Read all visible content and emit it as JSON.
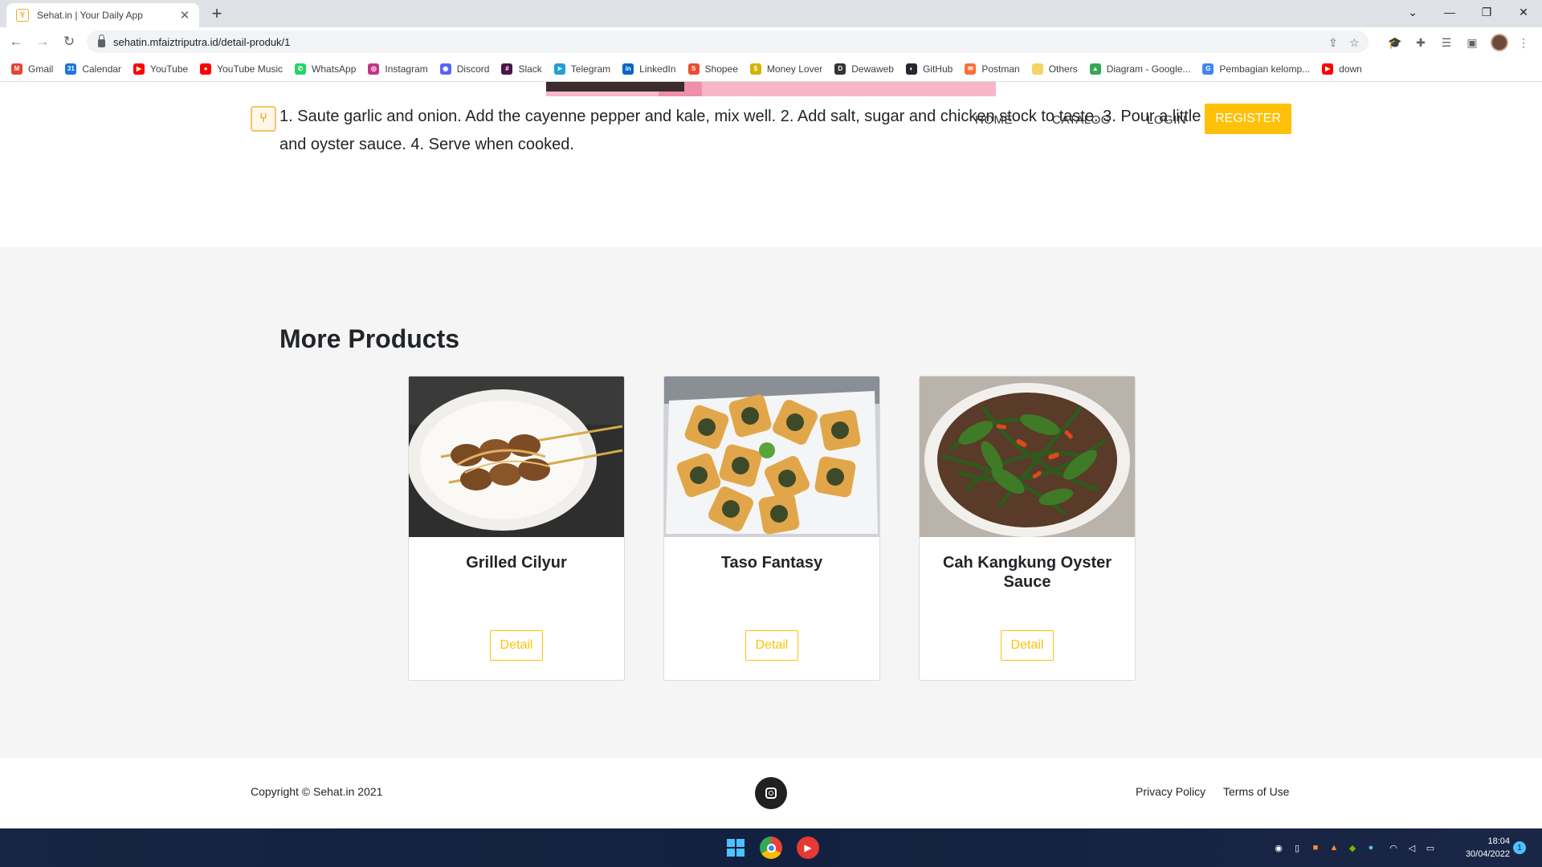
{
  "browser": {
    "tab_title": "Sehat.in | Your Daily App",
    "tab_close": "✕",
    "new_tab": "+",
    "url": "sehatin.mfaiztriputra.id/detail-produk/1",
    "back": "←",
    "forward": "→",
    "reload": "↻",
    "window_controls": {
      "dropdown": "⌄",
      "minimize": "—",
      "maximize": "❐",
      "close": "✕"
    },
    "bookmarks": [
      {
        "label": "Gmail",
        "icon": "gmail-icon",
        "color": "#ea4335",
        "glyph": "M"
      },
      {
        "label": "Calendar",
        "icon": "calendar-icon",
        "color": "#1a73e8",
        "glyph": "31"
      },
      {
        "label": "YouTube",
        "icon": "youtube-icon",
        "color": "#ff0000",
        "glyph": "▶"
      },
      {
        "label": "YouTube Music",
        "icon": "youtube-music-icon",
        "color": "#ff0000",
        "glyph": "●"
      },
      {
        "label": "WhatsApp",
        "icon": "whatsapp-icon",
        "color": "#25d366",
        "glyph": "✆"
      },
      {
        "label": "Instagram",
        "icon": "instagram-icon",
        "color": "#c13584",
        "glyph": "◎"
      },
      {
        "label": "Discord",
        "icon": "discord-icon",
        "color": "#5865f2",
        "glyph": "◉"
      },
      {
        "label": "Slack",
        "icon": "slack-icon",
        "color": "#4a154b",
        "glyph": "#"
      },
      {
        "label": "Telegram",
        "icon": "telegram-icon",
        "color": "#229ed9",
        "glyph": "➤"
      },
      {
        "label": "LinkedIn",
        "icon": "linkedin-icon",
        "color": "#0a66c2",
        "glyph": "in"
      },
      {
        "label": "Shopee",
        "icon": "shopee-icon",
        "color": "#ee4d2d",
        "glyph": "S"
      },
      {
        "label": "Money Lover",
        "icon": "money-lover-icon",
        "color": "#d4b400",
        "glyph": "$"
      },
      {
        "label": "Dewaweb",
        "icon": "dewaweb-icon",
        "color": "#333333",
        "glyph": "D"
      },
      {
        "label": "GitHub",
        "icon": "github-icon",
        "color": "#24292f",
        "glyph": "◐"
      },
      {
        "label": "Postman",
        "icon": "postman-icon",
        "color": "#ff6c37",
        "glyph": "✉"
      },
      {
        "label": "Others",
        "icon": "folder-icon",
        "color": "#f6d365",
        "glyph": ""
      },
      {
        "label": "Diagram - Google...",
        "icon": "google-drive-icon",
        "color": "#34a853",
        "glyph": "▲"
      },
      {
        "label": "Pembagian kelomp...",
        "icon": "google-icon",
        "color": "#4285f4",
        "glyph": "G"
      },
      {
        "label": "down",
        "icon": "youtube-icon",
        "color": "#ff0000",
        "glyph": "▶"
      }
    ]
  },
  "site": {
    "logo_glyph": "🍴",
    "nav": {
      "home": "HOME",
      "catalog": "CATALOG",
      "login": "LOGIN",
      "register": "REGISTER"
    },
    "recipe_text": "1. Saute garlic and onion. Add the cayenne pepper and kale, mix well. 2. Add salt, sugar and chicken stock to taste. 3. Pour a little and oyster sauce. 4. Serve when cooked.",
    "more_products": {
      "title": "More Products",
      "products": [
        {
          "name": "Grilled Cilyur",
          "button": "Detail"
        },
        {
          "name": "Taso Fantasy",
          "button": "Detail"
        },
        {
          "name": "Cah Kangkung Oyster Sauce",
          "button": "Detail"
        }
      ]
    },
    "footer": {
      "copyright": "Copyright © Sehat.in 2021",
      "privacy": "Privacy Policy",
      "terms": "Terms of Use"
    }
  },
  "taskbar": {
    "time": "18:04",
    "date": "30/04/2022",
    "notifications": "1"
  },
  "colors": {
    "accent": "#ffc107",
    "section_bg": "#f5f5f5",
    "taskbar": "#172443"
  }
}
